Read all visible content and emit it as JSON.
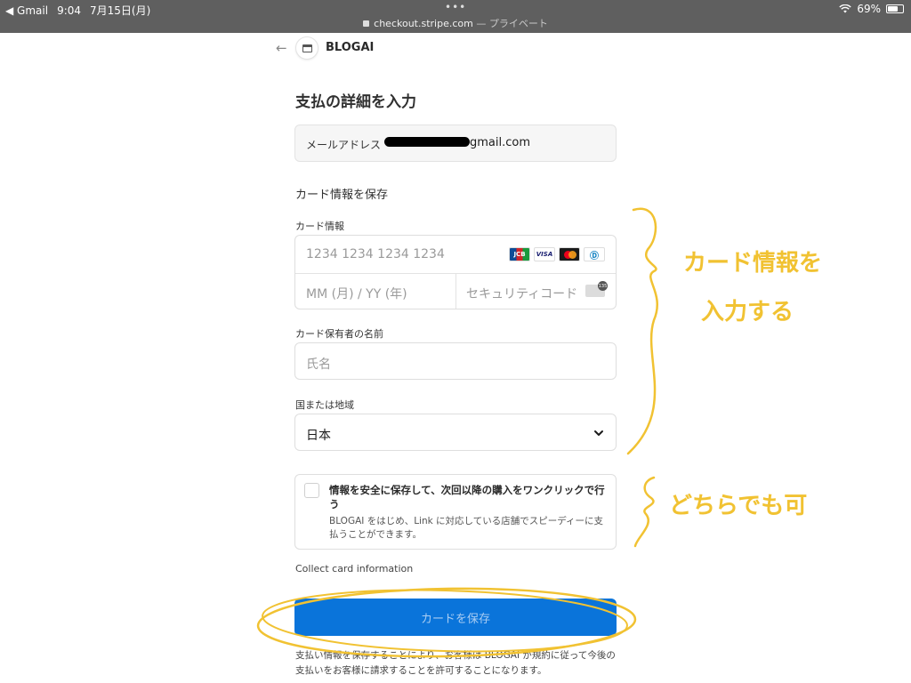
{
  "status_bar": {
    "back_app": "Gmail",
    "time": "9:04",
    "date": "7月15日(月)",
    "battery": "69%",
    "battery_level": 0.69
  },
  "url_bar": {
    "domain": "checkout.stripe.com",
    "suffix": " — プライベート"
  },
  "header": {
    "merchant_name": "BLOGAI"
  },
  "page_title": "支払の詳細を入力",
  "email": {
    "label": "メールアドレス",
    "value": "gmail.com"
  },
  "section_title": "カード情報を保存",
  "card": {
    "label": "カード情報",
    "number_placeholder": "1234 1234 1234 1234",
    "expiry_placeholder": "MM (月) / YY (年)",
    "cvc_placeholder": "セキュリティコード",
    "brands": [
      "JCB",
      "VISA",
      "",
      "Ⓓ"
    ],
    "cvc_badge": "135"
  },
  "cardholder": {
    "label": "カード保有者の名前",
    "placeholder": "氏名"
  },
  "country": {
    "label": "国または地域",
    "value": "日本"
  },
  "link_option": {
    "title": "情報を安全に保存して、次回以降の購入をワンクリックで行う",
    "description": "BLOGAI をはじめ、Link に対応している店舗でスピーディーに支払うことができます。"
  },
  "collect_text": "Collect card information",
  "submit_label": "カードを保存",
  "legal_text": "支払い情報を保存することにより、お客様は BLOGAI が規約に従って今後の支払いをお客様に請求することを許可することになります。",
  "annotations": {
    "card_note_line1": "カード情報を",
    "card_note_line2": "入力する",
    "optional_note": "どちらでも可",
    "color": "#f1c232"
  }
}
